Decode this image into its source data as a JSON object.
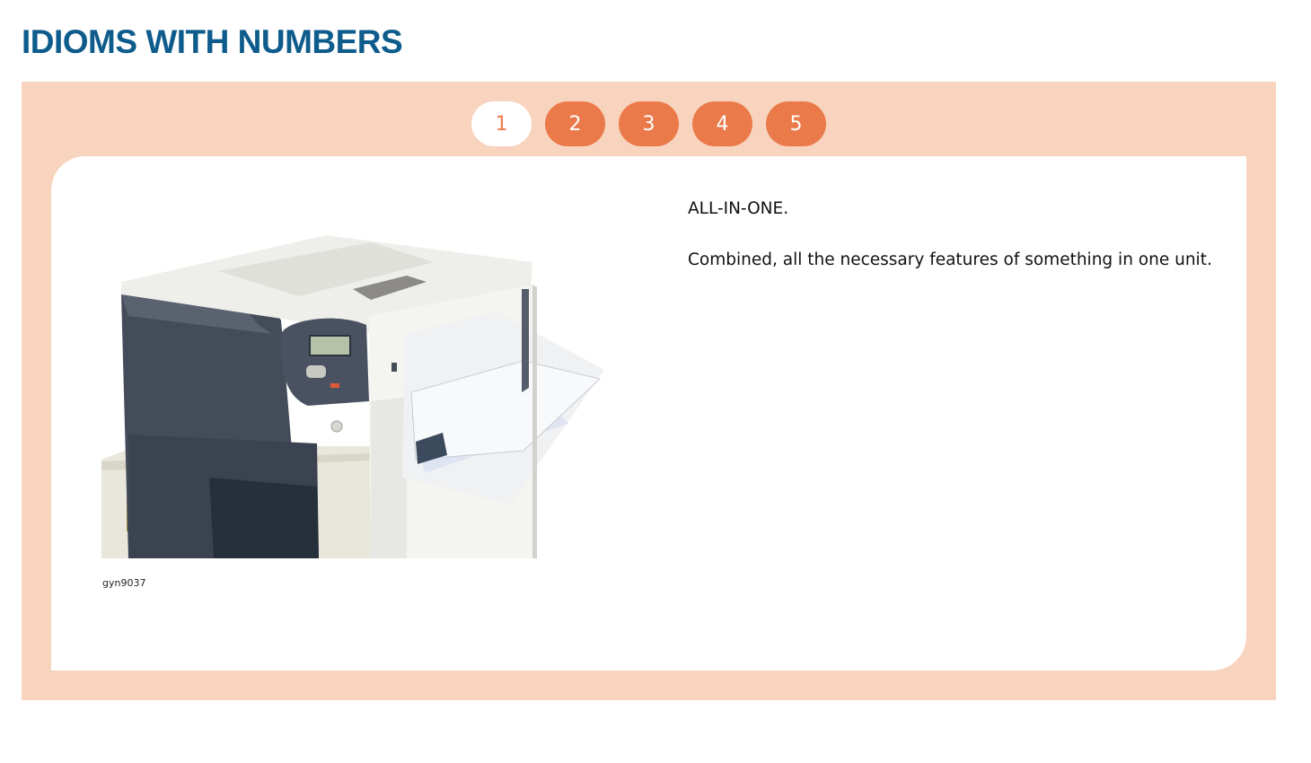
{
  "page": {
    "title": "IDIOMS WITH NUMBERS"
  },
  "tabs": [
    {
      "label": "1",
      "active": true
    },
    {
      "label": "2",
      "active": false
    },
    {
      "label": "3",
      "active": false
    },
    {
      "label": "4",
      "active": false
    },
    {
      "label": "5",
      "active": false
    }
  ],
  "card": {
    "idiom": "ALL-IN-ONE.",
    "definition": "Combined, all the necessary features of something in one unit.",
    "image_caption": "gyn9037",
    "image_icon": "printer-image"
  },
  "colors": {
    "title": "#0e5c8c",
    "panel_background": "#f8d3bd",
    "tab_accent": "#eb7a4b",
    "card_background": "#ffffff"
  }
}
